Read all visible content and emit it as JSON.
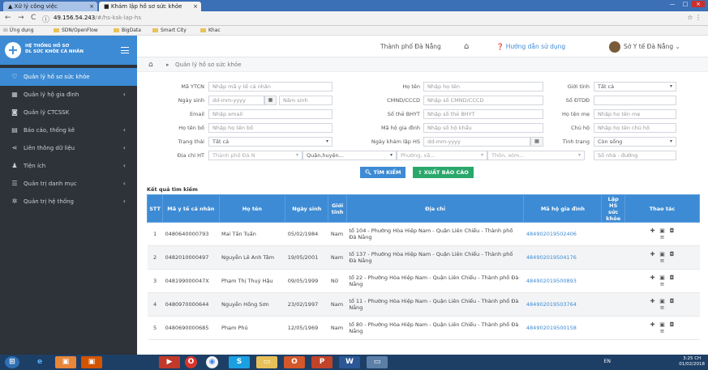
{
  "browser": {
    "tab1_title": "Xử lý công việc",
    "tab2_title": "Khám lập hồ sơ sức khỏe",
    "url_host": "49.156.54.243",
    "url_path": "/#/hs-ksk-lap-hs",
    "bookmarks": [
      "Ứng dụng",
      "SDN/OpenFlow",
      "BigData",
      "Smart City",
      "Khac"
    ]
  },
  "sidebar": {
    "brand_line1": "HỆ THỐNG HỒ SƠ",
    "brand_line2": "DL SỨC KHỎE CÁ NHÂN",
    "items": [
      {
        "label": "Quản lý hồ sơ sức khỏe",
        "icon": "heart-icon"
      },
      {
        "label": "Quản lý hộ gia đình",
        "icon": "building-icon"
      },
      {
        "label": "Quản lý CTCSSK",
        "icon": "camera-icon"
      },
      {
        "label": "Báo cáo, thống kê",
        "icon": "chart-icon"
      },
      {
        "label": "Liên thông dữ liệu",
        "icon": "share-icon"
      },
      {
        "label": "Tiện ích",
        "icon": "users-icon"
      },
      {
        "label": "Quản trị danh mục",
        "icon": "list-icon"
      },
      {
        "label": "Quản trị hệ thống",
        "icon": "gear-icon"
      }
    ]
  },
  "topbar": {
    "city": "Thành phố Đà Nẵng",
    "help": "Hướng dẫn sử dụng",
    "user": "Sở Y tế Đà Nẵng"
  },
  "breadcrumb": "Quản lý hồ sơ sức khỏe",
  "form": {
    "ma_ytcn_label": "Mã YTCN",
    "ma_ytcn_placeholder": "Nhập mã y tế cá nhân",
    "ho_ten_label": "Họ tên",
    "ho_ten_placeholder": "Nhập họ tên",
    "gioi_tinh_label": "Giới tính",
    "gioi_tinh_value": "Tất cả",
    "ngay_sinh_label": "Ngày sinh",
    "ngay_sinh_placeholder": "dd-mm-yyyy",
    "nam_sinh_placeholder": "Năm sinh",
    "cmnd_label": "CMND/CCCD",
    "cmnd_placeholder": "Nhập số CMND/CCCD",
    "so_dtdd_label": "Số ĐTDĐ",
    "email_label": "Email",
    "email_placeholder": "Nhập email",
    "bhyt_label": "Số thẻ BHYT",
    "bhyt_placeholder": "Nhập số thẻ BHYT",
    "ho_ten_me_label": "Họ tên mẹ",
    "ho_ten_me_placeholder": "Nhập họ tên mẹ",
    "ho_ten_bo_label": "Họ tên bố",
    "ho_ten_bo_placeholder": "Nhập họ tên bố",
    "ma_hgd_label": "Mã hộ gia đình",
    "ma_hgd_placeholder": "Nhập số hộ khẩu",
    "chu_ho_label": "Chủ hộ",
    "chu_ho_placeholder": "Nhập họ tên chủ hộ",
    "trang_thai_label": "Trạng thái",
    "trang_thai_value": "Tất cả",
    "ngay_kham_label": "Ngày khám lập HS",
    "ngay_kham_placeholder": "dd-mm-yyyy",
    "tinh_trang_label": "Tình trạng",
    "tinh_trang_value": "Còn sống",
    "dia_chi_label": "Địa chỉ HT",
    "city_value": "Thành phố Đà N",
    "district_value": "Quận,huyện...",
    "ward_value": "Phường, xã...",
    "village_value": "Thôn, xóm...",
    "house_placeholder": "Số nhà - đường",
    "search_button": "TÌM KIẾM",
    "export_button": "XUẤT BÁO CÁO"
  },
  "results": {
    "title": "Kết quả tìm kiếm",
    "columns": [
      "STT",
      "Mã y tế cá nhân",
      "Họ tên",
      "Ngày sinh",
      "Giới tính",
      "Địa chỉ",
      "Mã hộ gia đình",
      "Lập HS sức khỏe",
      "Thao tác"
    ],
    "rows": [
      {
        "stt": "1",
        "ma": "0480640000793",
        "ten": "Mai Tấn Tuấn",
        "ngay": "05/02/1984",
        "gt": "Nam",
        "dc": "tổ 104 - Phường Hòa Hiệp Nam - Quận Liên Chiểu - Thành phố Đà Nẵng",
        "hgd": "484902019502406"
      },
      {
        "stt": "2",
        "ma": "0482010000497",
        "ten": "Nguyễn Lê Anh Tâm",
        "ngay": "19/05/2001",
        "gt": "Nam",
        "dc": "tổ 137 - Phường Hòa Hiệp Nam - Quận Liên Chiểu - Thành phố Đà Nẵng",
        "hgd": "484902019504176"
      },
      {
        "stt": "3",
        "ma": "048199000047X",
        "ten": "Phạm Thị Thuý Hậu",
        "ngay": "09/05/1999",
        "gt": "Nữ",
        "dc": "tổ 22 - Phường Hòa Hiệp Nam - Quận Liên Chiểu - Thành phố Đà Nẵng",
        "hgd": "484902019500893"
      },
      {
        "stt": "4",
        "ma": "0480970000644",
        "ten": "Nguyễn Hồng Sơn",
        "ngay": "23/02/1997",
        "gt": "Nam",
        "dc": "tổ 11 - Phường Hòa Hiệp Nam - Quận Liên Chiểu - Thành phố Đà Nẵng",
        "hgd": "484902019503764"
      },
      {
        "stt": "5",
        "ma": "0480690000685",
        "ten": "Phạm Phú",
        "ngay": "12/05/1969",
        "gt": "Nam",
        "dc": "tổ 80 - Phường Hòa Hiệp Nam - Quận Liên Chiểu - Thành phố Đà Nẵng",
        "hgd": "484902019500158"
      }
    ]
  },
  "taskbar": {
    "lang": "EN",
    "time": "3:25 CH",
    "date": "01/02/2018"
  },
  "colors": {
    "primary": "#3d8bd4",
    "sidebar": "#2d3339",
    "export": "#2aa86b"
  }
}
